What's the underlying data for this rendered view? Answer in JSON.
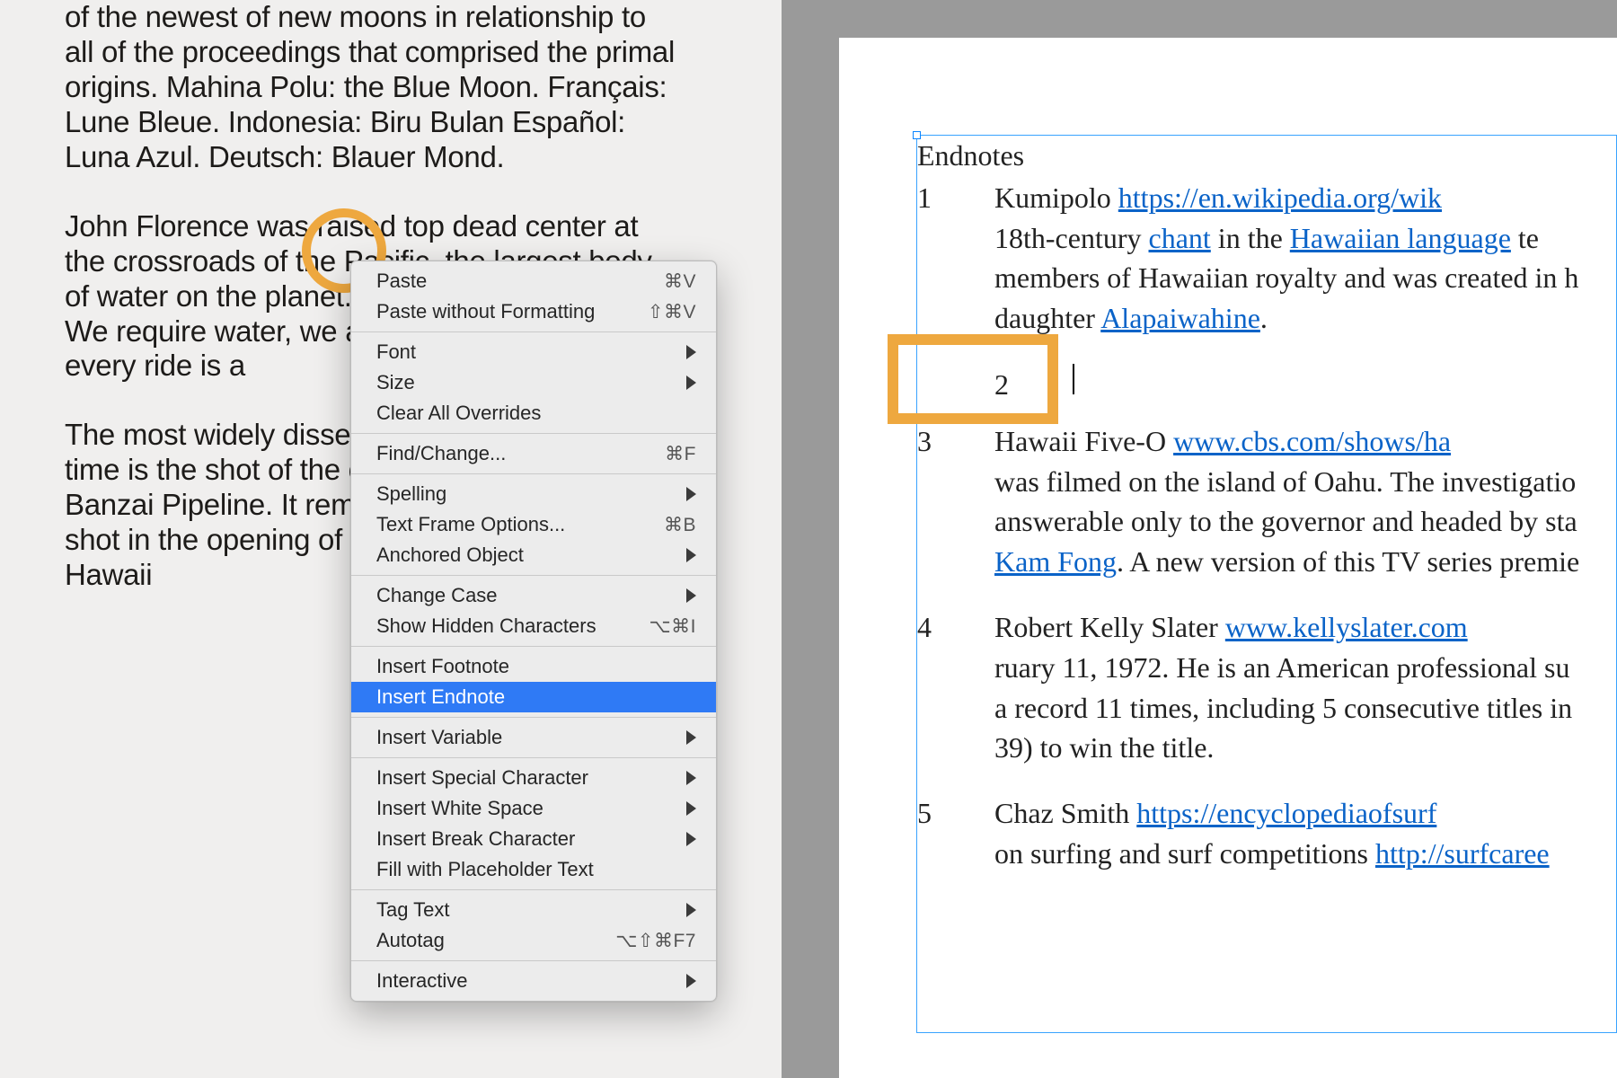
{
  "left_doc": {
    "p1": "of the newest of new moons in relationship to all of the proceedings that comprised the primal origins. Mahina Polu: the Blue Moon. Français: Lune Bleue. Indonesia: Biru Bulan Español: Luna Azul. Deutsch: Blauer Mond.",
    "p2": "John Florence was raised top dead center at the crossroads of the Pacific, the largest body of water on the planet. To be one with water. We require water, we are of water, wherein every ride is a",
    "p3": "The most widely disseminated surf image of all time is the shot of the opening credits at the Banzai Pipeline. It remains the most dominant shot in the opening of the television series Hawaii"
  },
  "context_menu": {
    "items": [
      {
        "label": "Paste",
        "shortcut": "⌘V",
        "submenu": false
      },
      {
        "label": "Paste without Formatting",
        "shortcut": "⇧⌘V",
        "submenu": false
      },
      {
        "sep": true
      },
      {
        "label": "Font",
        "submenu": true
      },
      {
        "label": "Size",
        "submenu": true
      },
      {
        "label": "Clear All Overrides",
        "submenu": false
      },
      {
        "sep": true
      },
      {
        "label": "Find/Change...",
        "shortcut": "⌘F",
        "submenu": false
      },
      {
        "sep": true
      },
      {
        "label": "Spelling",
        "submenu": true
      },
      {
        "label": "Text Frame Options...",
        "shortcut": "⌘B",
        "submenu": false
      },
      {
        "label": "Anchored Object",
        "submenu": true
      },
      {
        "sep": true
      },
      {
        "label": "Change Case",
        "submenu": true
      },
      {
        "label": "Show Hidden Characters",
        "shortcut": "⌥⌘I",
        "submenu": false
      },
      {
        "sep": true
      },
      {
        "label": "Insert Footnote",
        "submenu": false
      },
      {
        "label": "Insert Endnote",
        "submenu": false,
        "highlighted": true
      },
      {
        "sep": true
      },
      {
        "label": "Insert Variable",
        "submenu": true
      },
      {
        "sep": true
      },
      {
        "label": "Insert Special Character",
        "submenu": true
      },
      {
        "label": "Insert White Space",
        "submenu": true
      },
      {
        "label": "Insert Break Character",
        "submenu": true
      },
      {
        "label": "Fill with Placeholder Text",
        "submenu": false
      },
      {
        "sep": true
      },
      {
        "label": "Tag Text",
        "submenu": true
      },
      {
        "label": "Autotag",
        "shortcut": "⌥⇧⌘F7",
        "submenu": false
      },
      {
        "sep": true
      },
      {
        "label": "Interactive",
        "submenu": true
      }
    ]
  },
  "endnotes": {
    "heading": "Endnotes",
    "n1": {
      "num": "1",
      "lead": "Kumipolo ",
      "link1": "https://en.wikipedia.org/wik",
      "seg1": "18th-century ",
      "link2": "chant",
      "seg2": " in the ",
      "link3": "Hawaiian language",
      "seg3": " te",
      "seg4": "members of Hawaiian royalty and was created in h",
      "seg5": "daughter ",
      "link4": "Alapaiwahine",
      "seg6": "."
    },
    "n2": {
      "num": "2"
    },
    "n3": {
      "num": "3",
      "lead": "Hawaii Five-O ",
      "link1": "www.cbs.com/shows/ha",
      "seg1": "was filmed on the island of Oahu. The investigatio",
      "seg2": "answerable only to the governor and headed by sta",
      "link2": "Kam Fong",
      "seg3": ". A new version of this TV series premie"
    },
    "n4": {
      "num": "4",
      "lead": "Robert Kelly Slater ",
      "link1": "www.kellyslater.com",
      "seg1": "ruary 11, 1972. He is an American professional su",
      "seg2": "a record 11 times, including 5 consecutive titles in ",
      "seg3": "39) to win the title."
    },
    "n5": {
      "num": "5",
      "lead": "Chaz Smith ",
      "link1": "https://encyclopediaofsurf",
      "seg1": "on surfing and surf competitions ",
      "link2": "http://surfcaree"
    }
  },
  "annotations": {
    "circle_name": "annotation-circle-cursor-location",
    "rect_name": "annotation-rect-new-endnote"
  }
}
